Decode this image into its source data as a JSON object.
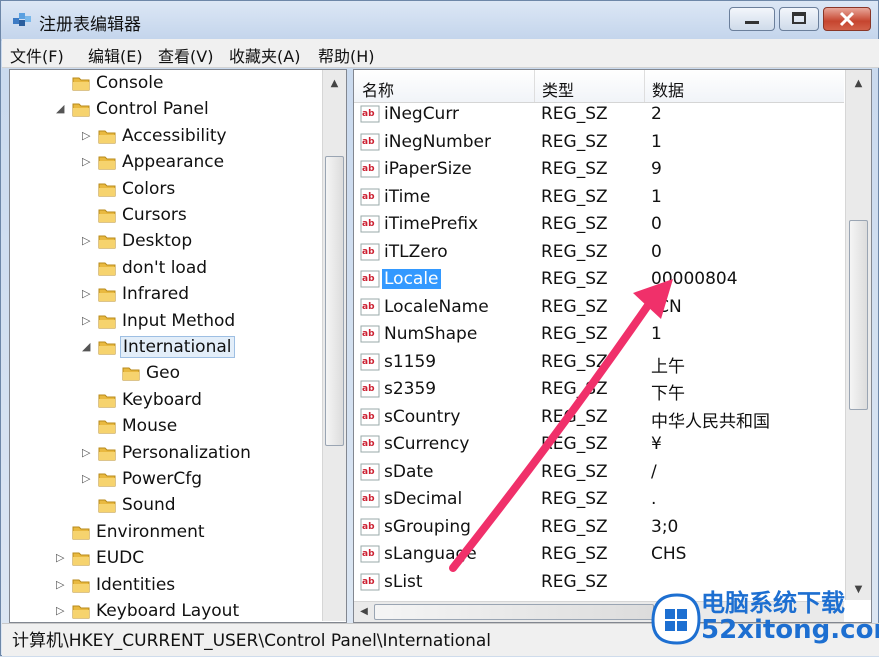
{
  "window": {
    "title": "注册表编辑器"
  },
  "menu": [
    "文件(F)",
    "编辑(E)",
    "查看(V)",
    "收藏夹(A)",
    "帮助(H)"
  ],
  "tree": [
    {
      "label": "Console",
      "level": 1,
      "expander": ""
    },
    {
      "label": "Control Panel",
      "level": 1,
      "expander": "open"
    },
    {
      "label": "Accessibility",
      "level": 2,
      "expander": "closed"
    },
    {
      "label": "Appearance",
      "level": 2,
      "expander": "closed"
    },
    {
      "label": "Colors",
      "level": 2,
      "expander": ""
    },
    {
      "label": "Cursors",
      "level": 2,
      "expander": ""
    },
    {
      "label": "Desktop",
      "level": 2,
      "expander": "closed"
    },
    {
      "label": "don't load",
      "level": 2,
      "expander": ""
    },
    {
      "label": "Infrared",
      "level": 2,
      "expander": "closed"
    },
    {
      "label": "Input Method",
      "level": 2,
      "expander": "closed"
    },
    {
      "label": "International",
      "level": 2,
      "expander": "open",
      "selected": true
    },
    {
      "label": "Geo",
      "level": 3,
      "expander": ""
    },
    {
      "label": "Keyboard",
      "level": 2,
      "expander": ""
    },
    {
      "label": "Mouse",
      "level": 2,
      "expander": ""
    },
    {
      "label": "Personalization",
      "level": 2,
      "expander": "closed"
    },
    {
      "label": "PowerCfg",
      "level": 2,
      "expander": "closed"
    },
    {
      "label": "Sound",
      "level": 2,
      "expander": ""
    },
    {
      "label": "Environment",
      "level": 1,
      "expander": ""
    },
    {
      "label": "EUDC",
      "level": 1,
      "expander": "closed"
    },
    {
      "label": "Identities",
      "level": 1,
      "expander": "closed"
    },
    {
      "label": "Keyboard Layout",
      "level": 1,
      "expander": "closed"
    }
  ],
  "columns": {
    "name": "名称",
    "type": "类型",
    "data": "数据"
  },
  "values": [
    {
      "name": "iNegCurr",
      "type": "REG_SZ",
      "data": "2"
    },
    {
      "name": "iNegNumber",
      "type": "REG_SZ",
      "data": "1"
    },
    {
      "name": "iPaperSize",
      "type": "REG_SZ",
      "data": "9"
    },
    {
      "name": "iTime",
      "type": "REG_SZ",
      "data": "1"
    },
    {
      "name": "iTimePrefix",
      "type": "REG_SZ",
      "data": "0"
    },
    {
      "name": "iTLZero",
      "type": "REG_SZ",
      "data": "0"
    },
    {
      "name": "Locale",
      "type": "REG_SZ",
      "data": "00000804",
      "selected": true
    },
    {
      "name": "LocaleName",
      "type": "REG_SZ",
      "data": "-CN"
    },
    {
      "name": "NumShape",
      "type": "REG_SZ",
      "data": "1"
    },
    {
      "name": "s1159",
      "type": "REG_SZ",
      "data": "上午"
    },
    {
      "name": "s2359",
      "type": "REG_SZ",
      "data": "下午"
    },
    {
      "name": "sCountry",
      "type": "REG_SZ",
      "data": "中华人民共和国"
    },
    {
      "name": "sCurrency",
      "type": "REG_SZ",
      "data": "¥"
    },
    {
      "name": "sDate",
      "type": "REG_SZ",
      "data": "/"
    },
    {
      "name": "sDecimal",
      "type": "REG_SZ",
      "data": "."
    },
    {
      "name": "sGrouping",
      "type": "REG_SZ",
      "data": "3;0"
    },
    {
      "name": "sLanguage",
      "type": "REG_SZ",
      "data": "CHS"
    },
    {
      "name": "sList",
      "type": "REG_SZ",
      "data": ""
    }
  ],
  "value_icon_text": "ab",
  "status": {
    "path": "计算机\\HKEY_CURRENT_USER\\Control Panel\\International"
  },
  "watermark": {
    "cn": "电脑系统下载",
    "en": "52xitong.com"
  },
  "colors": {
    "selection": "#3399ff",
    "arrow": "#f0306a",
    "watermark": "#1d6fd1"
  }
}
